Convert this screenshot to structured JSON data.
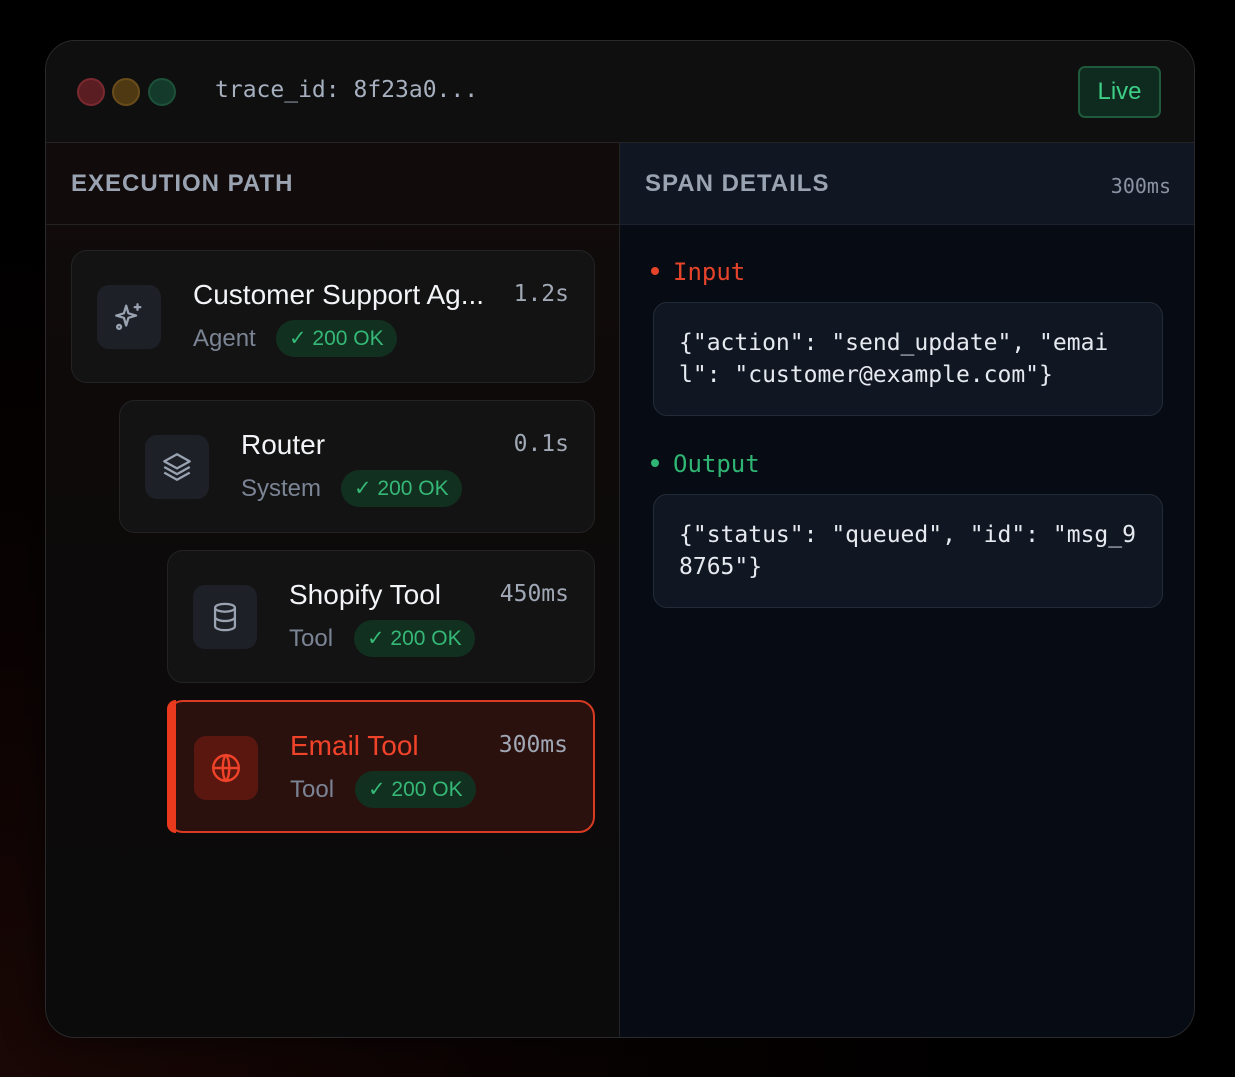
{
  "titlebar": {
    "trace": "trace_id: 8f23a0...",
    "live_label": "Live"
  },
  "execution": {
    "title": "EXECUTION PATH",
    "spans": [
      {
        "name": "Customer Support Ag...",
        "kind": "Agent",
        "duration": "1.2s",
        "status": "✓ 200 OK",
        "icon": "sparkles-icon"
      },
      {
        "name": "Router",
        "kind": "System",
        "duration": "0.1s",
        "status": "✓ 200 OK",
        "icon": "layers-icon"
      },
      {
        "name": "Shopify Tool",
        "kind": "Tool",
        "duration": "450ms",
        "status": "✓ 200 OK",
        "icon": "database-icon"
      },
      {
        "name": "Email Tool",
        "kind": "Tool",
        "duration": "300ms",
        "status": "✓ 200 OK",
        "icon": "globe-icon"
      }
    ]
  },
  "details": {
    "title": "SPAN DETAILS",
    "duration": "300ms",
    "input_label": "Input",
    "input_value": "{\"action\": \"send_update\", \"email\": \"customer@example.com\"}",
    "output_label": "Output",
    "output_value": "{\"status\": \"queued\", \"id\": \"msg_98765\"}"
  },
  "colors": {
    "accent": "#ea3a1e",
    "success": "#35b877",
    "input": "#e5432a",
    "output": "#2fb573"
  }
}
